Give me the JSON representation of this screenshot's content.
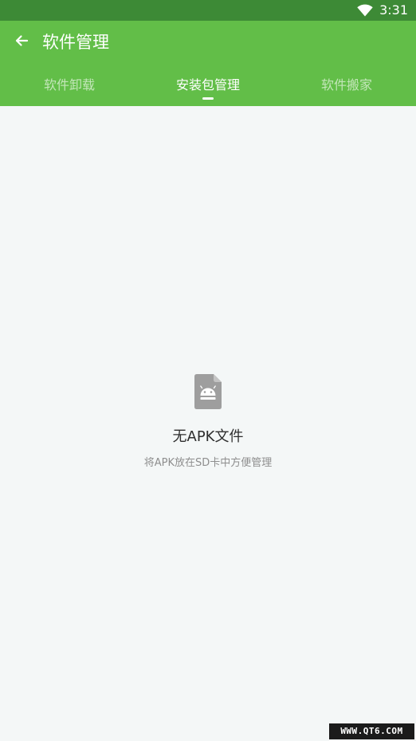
{
  "status_bar": {
    "time": "3:31",
    "icons": [
      "wifi-icon"
    ]
  },
  "header": {
    "back_icon": "arrow-left-icon",
    "title": "软件管理"
  },
  "tabs": [
    {
      "label": "软件卸载",
      "active": false
    },
    {
      "label": "安装包管理",
      "active": true
    },
    {
      "label": "软件搬家",
      "active": false
    }
  ],
  "empty_state": {
    "icon": "android-file-icon",
    "title": "无APK文件",
    "subtitle": "将APK放在SD卡中方便管理"
  },
  "watermark": {
    "text": "WWW.QT6.COM"
  },
  "colors": {
    "status_bar": "#3d8a36",
    "app_bar": "#62be48",
    "background": "#f4f7f7",
    "icon_gray": "#9e9e9e"
  }
}
